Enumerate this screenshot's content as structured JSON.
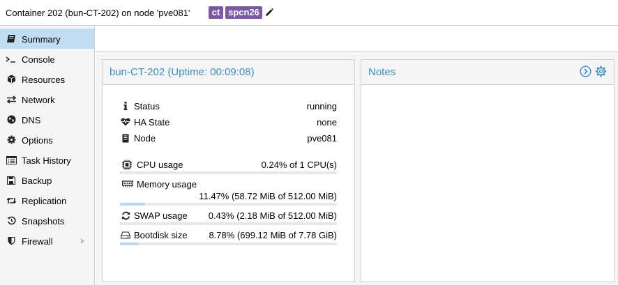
{
  "header": {
    "title": "Container 202 (bun-CT-202) on node 'pve081'",
    "tags": [
      "ct",
      "spcn26"
    ]
  },
  "sidebar": {
    "items": [
      {
        "label": "Summary",
        "icon": "book-icon",
        "active": true
      },
      {
        "label": "Console",
        "icon": "terminal-icon"
      },
      {
        "label": "Resources",
        "icon": "cube-icon"
      },
      {
        "label": "Network",
        "icon": "exchange-icon"
      },
      {
        "label": "DNS",
        "icon": "globe-icon"
      },
      {
        "label": "Options",
        "icon": "gear-icon"
      },
      {
        "label": "Task History",
        "icon": "list-icon"
      },
      {
        "label": "Backup",
        "icon": "floppy-icon"
      },
      {
        "label": "Replication",
        "icon": "retweet-icon"
      },
      {
        "label": "Snapshots",
        "icon": "history-icon"
      },
      {
        "label": "Firewall",
        "icon": "shield-icon",
        "has_submenu": true
      }
    ]
  },
  "status_panel": {
    "title": "bun-CT-202 (Uptime: 00:09:08)",
    "rows": [
      {
        "label": "Status",
        "value": "running",
        "icon": "info-icon"
      },
      {
        "label": "HA State",
        "value": "none",
        "icon": "heartbeat-icon"
      },
      {
        "label": "Node",
        "value": "pve081",
        "icon": "server-icon"
      }
    ],
    "usage": [
      {
        "label": "CPU usage",
        "value": "0.24% of 1 CPU(s)",
        "fraction": 0.0024,
        "icon": "cpu-icon"
      },
      {
        "label": "Memory usage",
        "value": "11.47% (58.72 MiB of 512.00 MiB)",
        "fraction": 0.1147,
        "icon": "memory-icon"
      },
      {
        "label": "SWAP usage",
        "value": "0.43% (2.18 MiB of 512.00 MiB)",
        "fraction": 0.0043,
        "icon": "refresh-icon"
      },
      {
        "label": "Bootdisk size",
        "value": "8.78% (699.12 MiB of 7.78 GiB)",
        "fraction": 0.0878,
        "icon": "hdd-icon"
      }
    ]
  },
  "notes_panel": {
    "title": "Notes",
    "actions": [
      "expand-icon",
      "gear-icon"
    ]
  },
  "colors": {
    "accent": "#3c8dc8",
    "tag": "#7b59a5",
    "active_nav": "#c1ddf1",
    "bar_fill": "#bcd6ec"
  }
}
